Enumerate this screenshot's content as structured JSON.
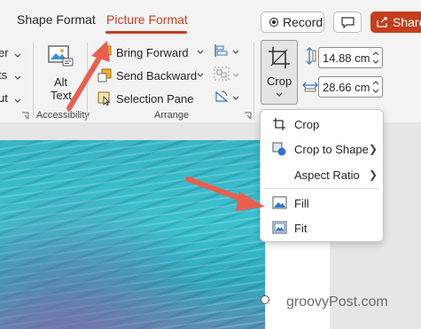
{
  "tabs": {
    "shape_format": "Shape Format",
    "picture_format": "Picture Format"
  },
  "toolbar": {
    "record": "Record",
    "share": "Share"
  },
  "accessibility": {
    "alt_line1": "Alt",
    "alt_line2": "Text",
    "label": "Accessibility"
  },
  "arrange": {
    "bring_forward": "Bring Forward",
    "send_backward": "Send Backward",
    "selection_pane": "Selection Pane",
    "label": "Arrange"
  },
  "left_cut": {
    "item1": "er",
    "item2": "ts",
    "item3": "ut"
  },
  "size": {
    "crop_label": "Crop",
    "height": "14.88 cm",
    "width": "28.66 cm"
  },
  "crop_menu": {
    "crop": "Crop",
    "crop_to_shape": "Crop to Shape",
    "aspect_ratio": "Aspect Ratio",
    "fill": "Fill",
    "fit": "Fit"
  },
  "watermark": "groovyPost.com",
  "colors": {
    "accent": "#c43e1c",
    "arrow": "#e85f4f",
    "ribbon": "#f3f3f3"
  }
}
